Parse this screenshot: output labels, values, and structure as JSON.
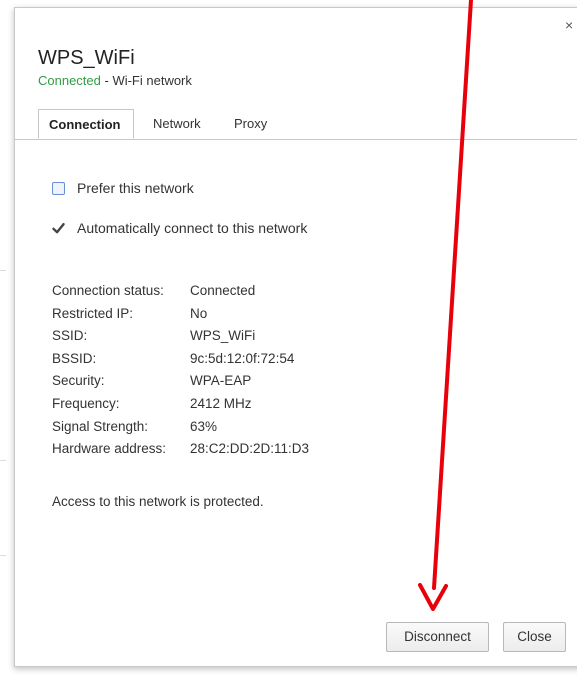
{
  "dialog": {
    "title": "WPS_WiFi",
    "status_word": "Connected",
    "subtitle_rest": " - Wi-Fi network",
    "close_glyph": "×"
  },
  "tabs": [
    {
      "label": "Connection",
      "active": true
    },
    {
      "label": "Network",
      "active": false
    },
    {
      "label": "Proxy",
      "active": false
    }
  ],
  "options": {
    "prefer_label": "Prefer this network",
    "prefer_checked": false,
    "autoconnect_label": "Automatically connect to this network",
    "autoconnect_checked": true
  },
  "info": [
    {
      "key": "Connection status:",
      "value": "Connected"
    },
    {
      "key": "Restricted IP:",
      "value": "No"
    },
    {
      "key": "SSID:",
      "value": "WPS_WiFi"
    },
    {
      "key": "BSSID:",
      "value": "9c:5d:12:0f:72:54"
    },
    {
      "key": "Security:",
      "value": "WPA-EAP"
    },
    {
      "key": "Frequency:",
      "value": "2412 MHz"
    },
    {
      "key": "Signal Strength:",
      "value": "63%"
    },
    {
      "key": "Hardware address:",
      "value": "28:C2:DD:2D:11:D3"
    }
  ],
  "note": "Access to this network is protected.",
  "buttons": {
    "disconnect": "Disconnect",
    "close": "Close"
  },
  "colors": {
    "status_green": "#2f9e44",
    "annotation_arrow": "#e8000b"
  }
}
